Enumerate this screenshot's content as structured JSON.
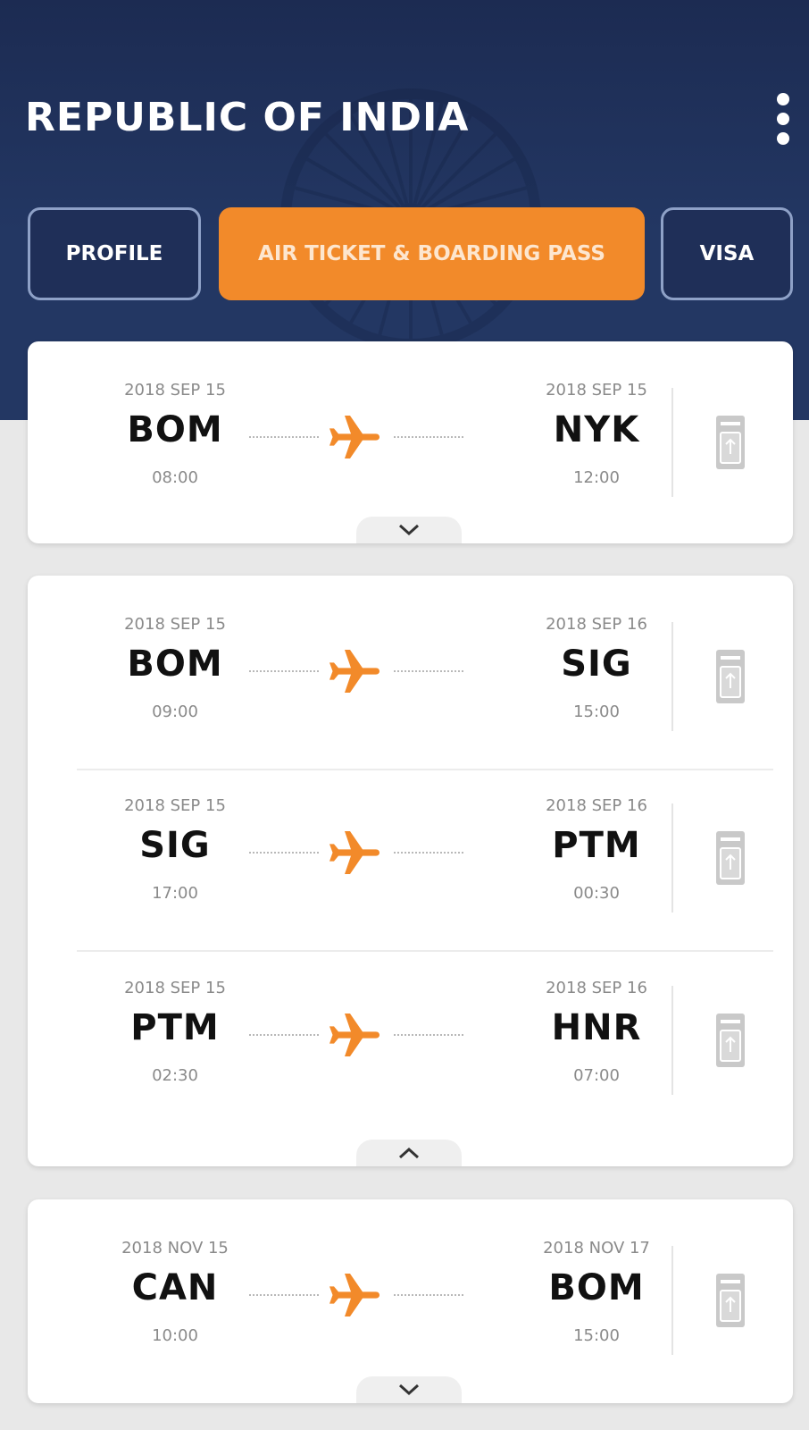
{
  "header": {
    "title": "REPUBLIC OF INDIA",
    "menu_icon": "more-vertical-icon",
    "background_color": "#233763"
  },
  "tabs": [
    {
      "label": "PROFILE",
      "active": false
    },
    {
      "label": "AIR TICKET & BOARDING PASS",
      "active": true
    },
    {
      "label": "VISA",
      "active": false
    }
  ],
  "accent_color": "#f28a2a",
  "cards": [
    {
      "expanded": false,
      "toggle_icon": "chevron-down-icon",
      "flights": [
        {
          "from": {
            "date": "2018 SEP 15",
            "code": "BOM",
            "time": "08:00"
          },
          "to": {
            "date": "2018 SEP 15",
            "code": "NYK",
            "time": "12:00"
          }
        }
      ]
    },
    {
      "expanded": true,
      "toggle_icon": "chevron-up-icon",
      "flights": [
        {
          "from": {
            "date": "2018 SEP 15",
            "code": "BOM",
            "time": "09:00"
          },
          "to": {
            "date": "2018 SEP 16",
            "code": "SIG",
            "time": "15:00"
          }
        },
        {
          "from": {
            "date": "2018 SEP 15",
            "code": "SIG",
            "time": "17:00"
          },
          "to": {
            "date": "2018 SEP 16",
            "code": "PTM",
            "time": "00:30"
          }
        },
        {
          "from": {
            "date": "2018 SEP 15",
            "code": "PTM",
            "time": "02:30"
          },
          "to": {
            "date": "2018 SEP 16",
            "code": "HNR",
            "time": "07:00"
          }
        }
      ]
    },
    {
      "expanded": false,
      "toggle_icon": "chevron-down-icon",
      "flights": [
        {
          "from": {
            "date": "2018 NOV 15",
            "code": "CAN",
            "time": "10:00"
          },
          "to": {
            "date": "2018 NOV 17",
            "code": "BOM",
            "time": "15:00"
          }
        }
      ]
    }
  ]
}
